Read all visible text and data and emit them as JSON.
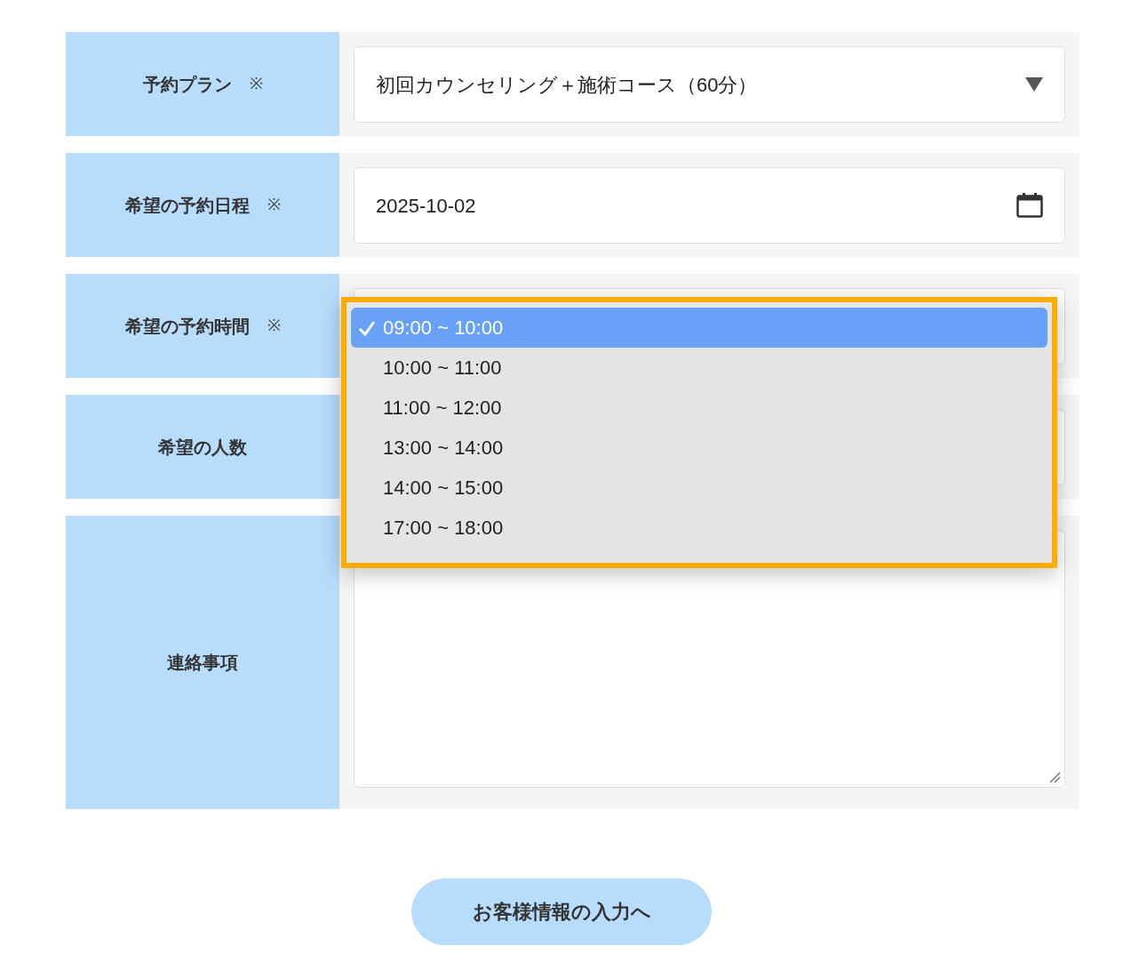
{
  "form": {
    "rows": [
      {
        "kind": "select",
        "label": "予約プラン",
        "required_mark": "※",
        "value": "初回カウンセリング＋施術コース（60分）"
      },
      {
        "kind": "date",
        "label": "希望の予約日程",
        "required_mark": "※",
        "value": "2025-10-02"
      },
      {
        "kind": "time",
        "label": "希望の予約時間",
        "required_mark": "※"
      },
      {
        "kind": "count",
        "label": "希望の人数"
      },
      {
        "kind": "textarea",
        "label": "連絡事項"
      }
    ]
  },
  "time_dropdown": {
    "options": [
      {
        "label": "09:00 ~ 10:00",
        "selected": true
      },
      {
        "label": "10:00 ~ 11:00",
        "selected": false
      },
      {
        "label": "11:00 ~ 12:00",
        "selected": false
      },
      {
        "label": "13:00 ~ 14:00",
        "selected": false
      },
      {
        "label": "14:00 ~ 15:00",
        "selected": false
      },
      {
        "label": "17:00 ~ 18:00",
        "selected": false
      }
    ]
  },
  "next_button": {
    "label": "お客様情報の入力へ"
  }
}
